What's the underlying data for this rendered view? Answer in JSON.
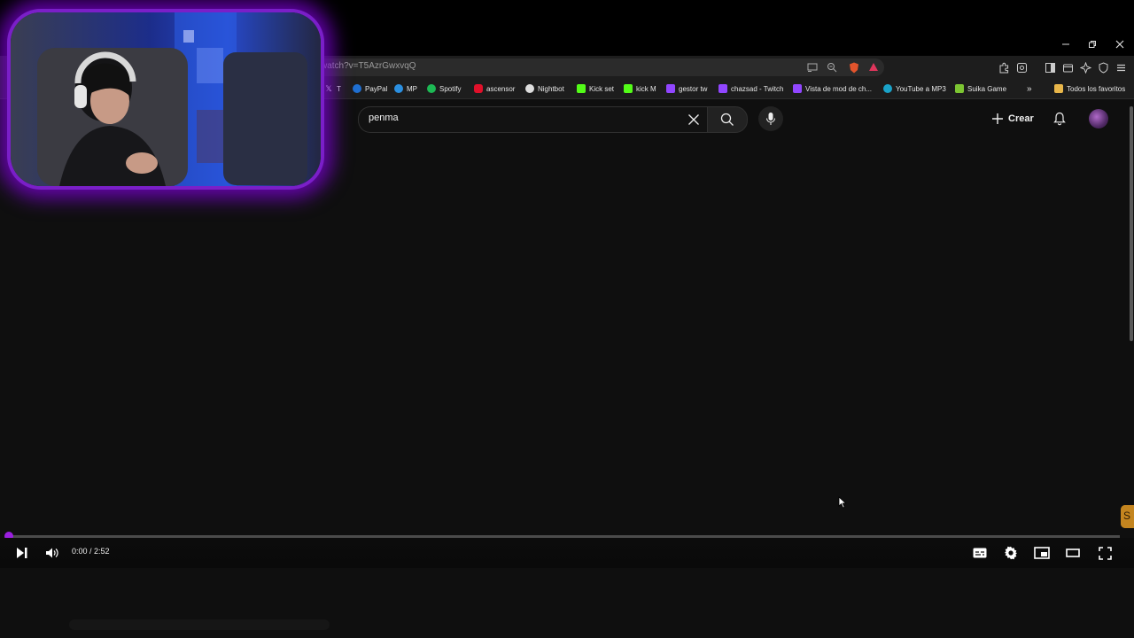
{
  "browser": {
    "url": "watch?v=T5AzrGwxvqQ",
    "bookmarks": [
      {
        "label": "T",
        "icon": "x-logo-icon",
        "color": "#ffffff"
      },
      {
        "label": "PayPal",
        "icon": "paypal-icon",
        "color": "#1f6fd1"
      },
      {
        "label": "MP",
        "icon": "mercadopago-icon",
        "color": "#2b8fe0"
      },
      {
        "label": "Spotify",
        "icon": "spotify-icon",
        "color": "#1db954"
      },
      {
        "label": "ascensor",
        "icon": "youtube-icon",
        "color": "#e0102a"
      },
      {
        "label": "Nightbot",
        "icon": "nightbot-icon",
        "color": "#dddddd"
      },
      {
        "label": "Kick set",
        "icon": "kick-icon",
        "color": "#53fc18"
      },
      {
        "label": "kick M",
        "icon": "kick-icon",
        "color": "#53fc18"
      },
      {
        "label": "gestor tw",
        "icon": "twitch-icon",
        "color": "#9146ff"
      },
      {
        "label": "chazsad - Twitch",
        "icon": "twitch-icon",
        "color": "#9146ff"
      },
      {
        "label": "Vista de mod de ch...",
        "icon": "twitch-icon",
        "color": "#9146ff"
      },
      {
        "label": "YouTube a MP3",
        "icon": "converter-icon",
        "color": "#1aa3c9"
      },
      {
        "label": "Suika Game",
        "icon": "suika-icon",
        "color": "#7cc532"
      },
      {
        "label": "Todos los favoritos",
        "icon": "folder-icon",
        "color": "#e8b64a"
      }
    ]
  },
  "youtube": {
    "search_value": "penma",
    "create_label": "Crear"
  },
  "player": {
    "time_display": "0:00 / 2:52",
    "progress_fraction": 0.0
  },
  "colors": {
    "accent": "#a01ee0",
    "webcam_glow": "#7a1fc8",
    "background": "#0f0f0f"
  }
}
